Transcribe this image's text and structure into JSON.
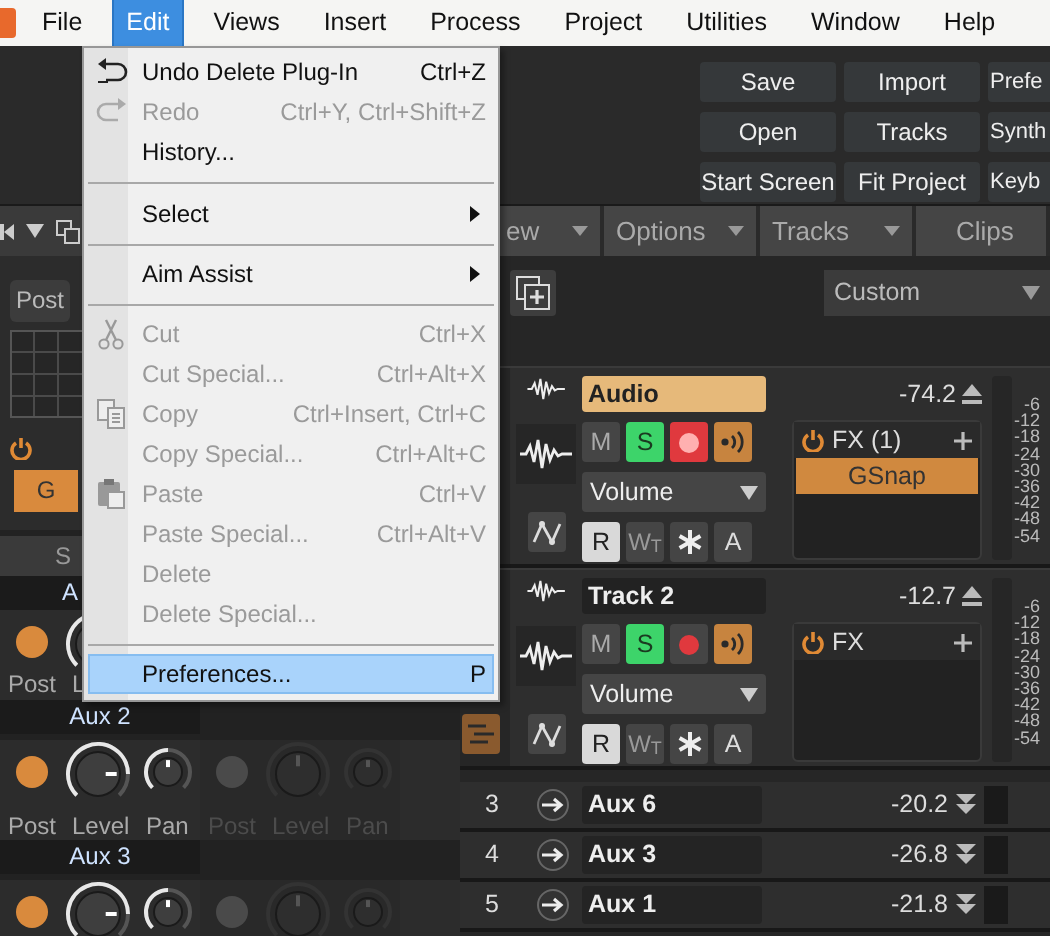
{
  "menubar": [
    {
      "label": "File",
      "selected": false
    },
    {
      "label": "Edit",
      "selected": true
    },
    {
      "label": "Views",
      "selected": false
    },
    {
      "label": "Insert",
      "selected": false
    },
    {
      "label": "Process",
      "selected": false
    },
    {
      "label": "Project",
      "selected": false
    },
    {
      "label": "Utilities",
      "selected": false
    },
    {
      "label": "Window",
      "selected": false
    },
    {
      "label": "Help",
      "selected": false
    }
  ],
  "control_bar": {
    "buttons": [
      "Save",
      "Import",
      "Prefe",
      "Open",
      "Tracks",
      "Synth",
      "Start Screen",
      "Fit Project",
      "Keyb"
    ]
  },
  "edit_menu": [
    {
      "kind": "item",
      "label": "Undo Delete Plug-In",
      "shortcut": "Ctrl+Z",
      "disabled": false,
      "submenu": false,
      "selected": false
    },
    {
      "kind": "item",
      "label": "Redo",
      "shortcut": "Ctrl+Y, Ctrl+Shift+Z",
      "disabled": true,
      "submenu": false,
      "selected": false
    },
    {
      "kind": "item",
      "label": "History...",
      "disabled": false,
      "submenu": false,
      "selected": false
    },
    {
      "kind": "separator"
    },
    {
      "kind": "item",
      "label": "Select",
      "disabled": false,
      "submenu": true,
      "selected": false
    },
    {
      "kind": "separator"
    },
    {
      "kind": "item",
      "label": "Aim Assist",
      "disabled": false,
      "submenu": true,
      "selected": false
    },
    {
      "kind": "separator"
    },
    {
      "kind": "item",
      "label": "Cut",
      "shortcut": "Ctrl+X",
      "disabled": true,
      "submenu": false,
      "selected": false
    },
    {
      "kind": "item",
      "label": "Cut Special...",
      "shortcut": "Ctrl+Alt+X",
      "disabled": true,
      "submenu": false,
      "selected": false
    },
    {
      "kind": "item",
      "label": "Copy",
      "shortcut": "Ctrl+Insert, Ctrl+C",
      "disabled": true,
      "submenu": false,
      "selected": false
    },
    {
      "kind": "item",
      "label": "Copy Special...",
      "shortcut": "Ctrl+Alt+C",
      "disabled": true,
      "submenu": false,
      "selected": false
    },
    {
      "kind": "item",
      "label": "Paste",
      "shortcut": "Ctrl+V",
      "disabled": true,
      "submenu": false,
      "selected": false
    },
    {
      "kind": "item",
      "label": "Paste Special...",
      "shortcut": "Ctrl+Alt+V",
      "disabled": true,
      "submenu": false,
      "selected": false
    },
    {
      "kind": "item",
      "label": "Delete",
      "disabled": true,
      "submenu": false,
      "selected": false
    },
    {
      "kind": "item",
      "label": "Delete Special...",
      "disabled": true,
      "submenu": false,
      "selected": false
    },
    {
      "kind": "separator"
    },
    {
      "kind": "item",
      "label": "Preferences...",
      "shortcut": "P",
      "disabled": false,
      "submenu": false,
      "selected": true
    }
  ],
  "inspector": {
    "post_button": "Post",
    "fx_button": "G",
    "tab": "S"
  },
  "sends": [
    {
      "header": "A",
      "units": [
        {
          "active": true,
          "post": "Post",
          "level_label": "L"
        }
      ]
    },
    {
      "header": "Aux 2",
      "units": [
        {
          "active": true,
          "post": "Post",
          "level_label": "Level",
          "pan_label": "Pan",
          "pan_knob": true
        },
        {
          "active": false,
          "post": "Post",
          "level_label": "Level",
          "pan_label": "Pan",
          "pan_knob": true
        }
      ]
    },
    {
      "header": "Aux 3",
      "units": [
        {
          "active": true,
          "pan_knob": true
        },
        {
          "active": false,
          "pan_knob": true
        }
      ]
    }
  ],
  "view_tabs": [
    {
      "label": "ew",
      "dropdown": true
    },
    {
      "label": "Options",
      "dropdown": true
    },
    {
      "label": "Tracks",
      "dropdown": true
    },
    {
      "label": "Clips",
      "dropdown": false
    }
  ],
  "track_toolbar": {
    "preset": "Custom"
  },
  "tracks": [
    {
      "name": "Audio",
      "selected": true,
      "value": "-74.2",
      "mute": {
        "label": "M",
        "on": false
      },
      "solo": {
        "label": "S",
        "on": true
      },
      "armed": true,
      "monitor": true,
      "automation": "Volume",
      "read": {
        "label": "R",
        "on": true
      },
      "write": {
        "label": "W$_{T}$",
        "on": false
      },
      "auto_label": "A",
      "fx": {
        "title": "FX (1)",
        "plugins": [
          "GSnap"
        ]
      },
      "lanes": false,
      "scale": [
        "-6",
        "-12",
        "-18",
        "-24",
        "-30",
        "-36",
        "-42",
        "-48",
        "-54"
      ]
    },
    {
      "name": "Track 2",
      "selected": false,
      "value": "-12.7",
      "mute": {
        "label": "M",
        "on": false
      },
      "solo": {
        "label": "S",
        "on": true
      },
      "armed": false,
      "monitor": true,
      "automation": "Volume",
      "read": {
        "label": "R",
        "on": true
      },
      "write": {
        "label": "W$_{T}$",
        "on": false
      },
      "auto_label": "A",
      "fx": {
        "title": "FX"
      },
      "lanes": true,
      "scale": [
        "-6",
        "-12",
        "-18",
        "-24",
        "-30",
        "-36",
        "-42",
        "-48",
        "-54"
      ]
    }
  ],
  "aux_tracks": [
    {
      "number": "3",
      "name": "Aux 6",
      "value": "-20.2"
    },
    {
      "number": "4",
      "name": "Aux 3",
      "value": "-26.8"
    },
    {
      "number": "5",
      "name": "Aux 1",
      "value": "-21.8"
    }
  ]
}
